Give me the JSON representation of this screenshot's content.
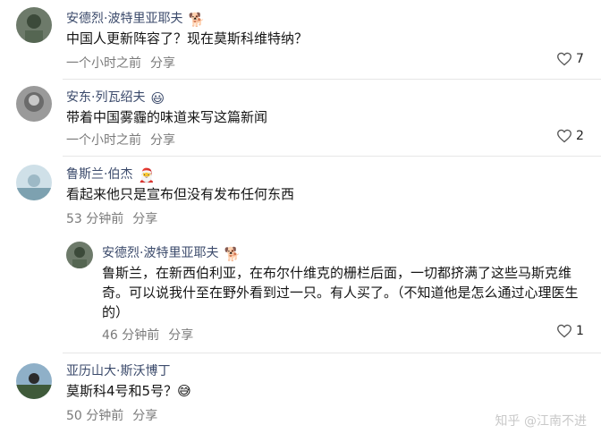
{
  "comments": [
    {
      "name": "安德烈·波特里亚耶夫",
      "badge": "🐕",
      "text": "中国人更新阵容了？现在莫斯科维特纳？",
      "time": "一个小时之前",
      "share": "分享",
      "likes": "7"
    },
    {
      "name": "安东·列瓦绍夫",
      "badge": "😃",
      "text": "带着中国雾霾的味道来写这篇新闻",
      "time": "一个小时之前",
      "share": "分享",
      "likes": "2"
    },
    {
      "name": "鲁斯兰·伯杰",
      "badge": "🎅",
      "text": "看起来他只是宣布但没有发布任何东西",
      "time": "53 分钟前",
      "share": "分享",
      "likes": ""
    },
    {
      "name": "安德烈·波特里亚耶夫",
      "badge": "🐕",
      "text": "鲁斯兰，在新西伯利亚，在布尔什维克的栅栏后面，一切都挤满了这些马斯克维奇。可以说我什至在野外看到过一只。有人买了。（不知道他是怎么通过心理医生的）",
      "time": "46 分钟前",
      "share": "分享",
      "likes": "1"
    },
    {
      "name": "亚历山大·斯沃博丁",
      "badge": "",
      "text": "莫斯科4号和5号？😅",
      "time": "50 分钟前",
      "share": "分享",
      "likes": ""
    }
  ],
  "watermark": "知乎 @江南不进",
  "colors": {
    "name": "#3b4a6b",
    "meta": "#7a7a7a",
    "divider": "#e6e6e6"
  }
}
